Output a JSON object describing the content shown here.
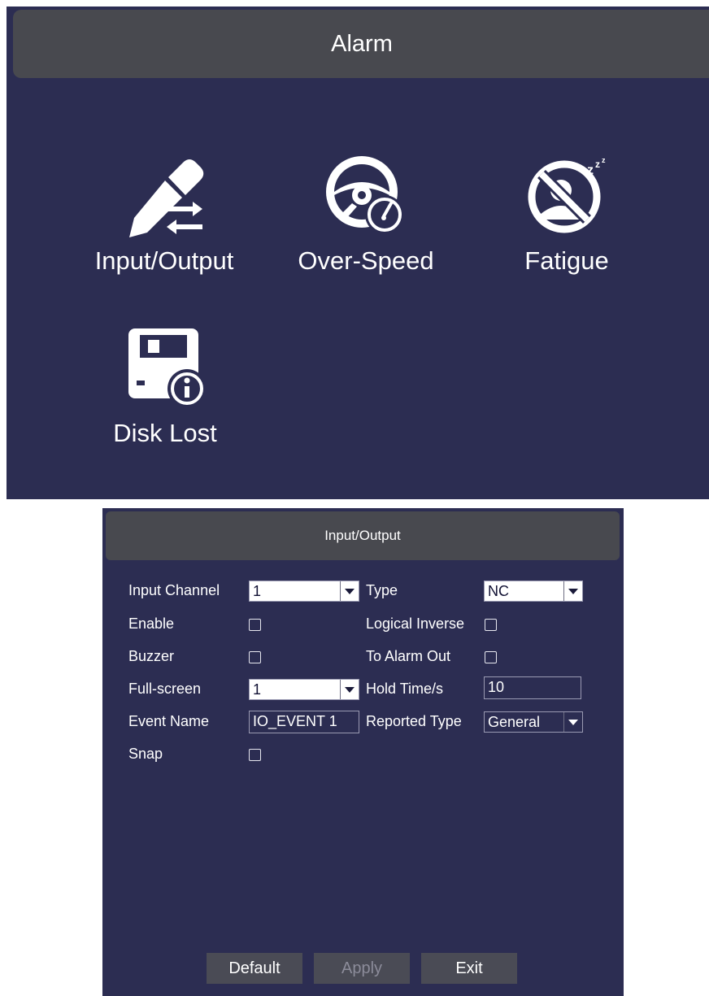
{
  "alarm_menu": {
    "title": "Alarm",
    "tiles": [
      {
        "label": "Input/Output",
        "icon": "pencil-arrows-icon"
      },
      {
        "label": "Over-Speed",
        "icon": "steering-speedometer-icon"
      },
      {
        "label": "Fatigue",
        "icon": "no-sleeping-icon"
      },
      {
        "label": "Disk Lost",
        "icon": "floppy-disk-info-icon"
      }
    ]
  },
  "io_dialog": {
    "title": "Input/Output",
    "input_channel": {
      "label": "Input Channel",
      "value": "1"
    },
    "type": {
      "label": "Type",
      "value": "NC"
    },
    "enable": {
      "label": "Enable",
      "checked": false
    },
    "logical_inverse": {
      "label": "Logical Inverse",
      "checked": false
    },
    "buzzer": {
      "label": "Buzzer",
      "checked": false
    },
    "to_alarm_out": {
      "label": "To Alarm Out",
      "checked": false
    },
    "full_screen": {
      "label": "Full-screen",
      "value": "1"
    },
    "hold_time": {
      "label": "Hold Time/s",
      "value": "10"
    },
    "event_name": {
      "label": "Event Name",
      "value": "IO_EVENT 1"
    },
    "reported_type": {
      "label": "Reported Type",
      "value": "General"
    },
    "snap": {
      "label": "Snap",
      "checked": false
    },
    "buttons": {
      "default": "Default",
      "apply": "Apply",
      "exit": "Exit"
    }
  },
  "colors": {
    "panel_bg": "#2c2d52",
    "titlebar_bg": "#48494f",
    "button_bg": "#4a4b55",
    "text": "#ffffff",
    "disabled_text": "#8c8c9a"
  }
}
